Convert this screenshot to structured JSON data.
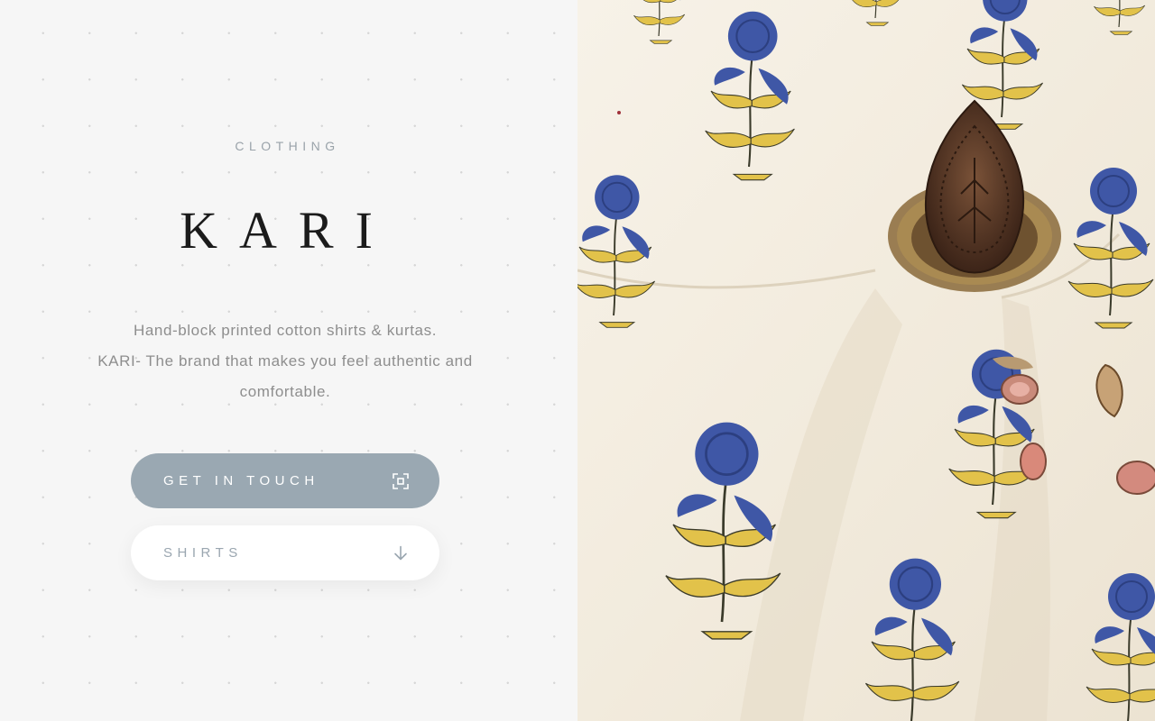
{
  "hero": {
    "eyebrow": "CLOTHING",
    "brand": "KARI",
    "tagline_line1": "Hand-block printed cotton shirts & kurtas.",
    "tagline_line2": "KARI- The brand that makes you feel authentic and comfortable."
  },
  "buttons": {
    "contact_label": "GET IN TOUCH",
    "contact_icon": "scan-frame-icon",
    "shirts_label": "SHIRTS",
    "shirts_icon": "arrow-down-icon"
  },
  "image": {
    "alt": "Hand-block printed cotton fabric with blue and yellow floral motifs and a wooden printing block"
  },
  "colors": {
    "background": "#f6f6f6",
    "accent": "#9aa8b2",
    "brand_text": "#1b1b1b",
    "muted_text": "#8e8e8e",
    "fabric_base": "#f3ecdf",
    "flower_blue": "#3f57a6",
    "leaf_yellow": "#e2c24a",
    "block_brown": "#5a3826"
  }
}
